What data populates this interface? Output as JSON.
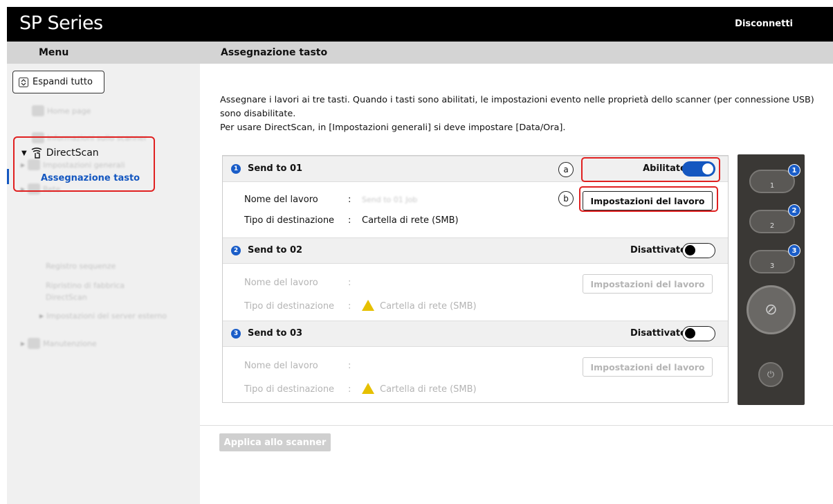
{
  "header": {
    "brand": "SP Series",
    "logout": "Disconnetti"
  },
  "subheader": {
    "menu": "Menu",
    "page_title": "Assegnazione tasto"
  },
  "sidebar": {
    "expand_all": "Espandi tutto",
    "blurred_items": [
      "Home page",
      "Informazioni sullo scanner",
      "Impostazioni generali",
      "Rete"
    ],
    "directscan": {
      "label": "DirectScan",
      "active_sub": "Assegnazione tasto",
      "other_subs": [
        "Registro sequenze",
        "Ripristino di fabbrica DirectScan",
        "Impostazioni del server esterno"
      ]
    },
    "maintenance": "Manutenzione"
  },
  "intro": {
    "line1": "Assegnare i lavori ai tre tasti. Quando i tasti sono abilitati, le impostazioni evento nelle proprietà dello scanner (per connessione USB) sono disabilitate.",
    "line2": "Per usare DirectScan, in [Impostazioni generali] si deve impostare [Data/Ora]."
  },
  "labels": {
    "job_name": "Nome del lavoro",
    "dest_type": "Tipo di destinazione",
    "colon": ":",
    "job_settings": "Impostazioni del lavoro",
    "callout_a": "a",
    "callout_b": "b"
  },
  "sections": [
    {
      "num": "1",
      "name": "Send to 01",
      "status": "Abilitato",
      "enabled": true,
      "job_name": "Send to 01 Job",
      "dest": "Cartella di rete (SMB)"
    },
    {
      "num": "2",
      "name": "Send to 02",
      "status": "Disattivato",
      "enabled": false,
      "job_name": "",
      "dest": "Cartella di rete (SMB)"
    },
    {
      "num": "3",
      "name": "Send to 03",
      "status": "Disattivato",
      "enabled": false,
      "job_name": "",
      "dest": "Cartella di rete (SMB)"
    }
  ],
  "device": {
    "buttons": [
      "1",
      "2",
      "3"
    ],
    "badges": [
      "1",
      "2",
      "3"
    ]
  },
  "footer": {
    "apply": "Applica allo scanner"
  },
  "colors": {
    "accent": "#1457c0",
    "highlight": "#e02020",
    "warning": "#e6c000"
  }
}
